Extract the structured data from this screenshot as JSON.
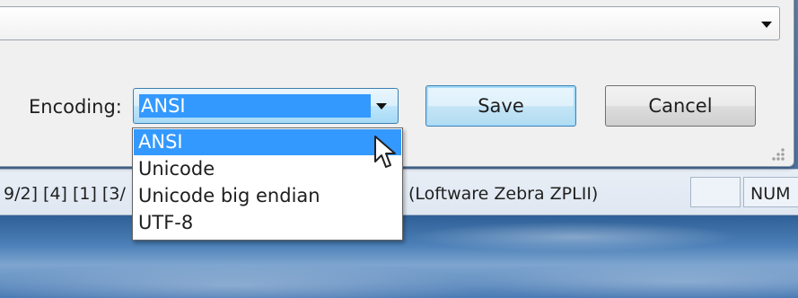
{
  "dialog": {
    "top_combo_value": "",
    "encoding_label": "Encoding:",
    "encoding_select": {
      "value": "ANSI",
      "options": [
        "ANSI",
        "Unicode",
        "Unicode big endian",
        "UTF-8"
      ],
      "selected_index": 0
    },
    "save_label": "Save",
    "cancel_label": "Cancel"
  },
  "statusbar": {
    "left_text": "9/2] [4] [1] [3/",
    "mid_text": "(Loftware Zebra ZPLII)",
    "indicator": "NUM"
  },
  "icons": {
    "dropdown_arrow": "chevron-down-icon",
    "cursor": "mouse-pointer-icon",
    "grip": "resize-grip-icon"
  },
  "colors": {
    "selection": "#3399ff",
    "focus_border": "#3c7fb1"
  }
}
